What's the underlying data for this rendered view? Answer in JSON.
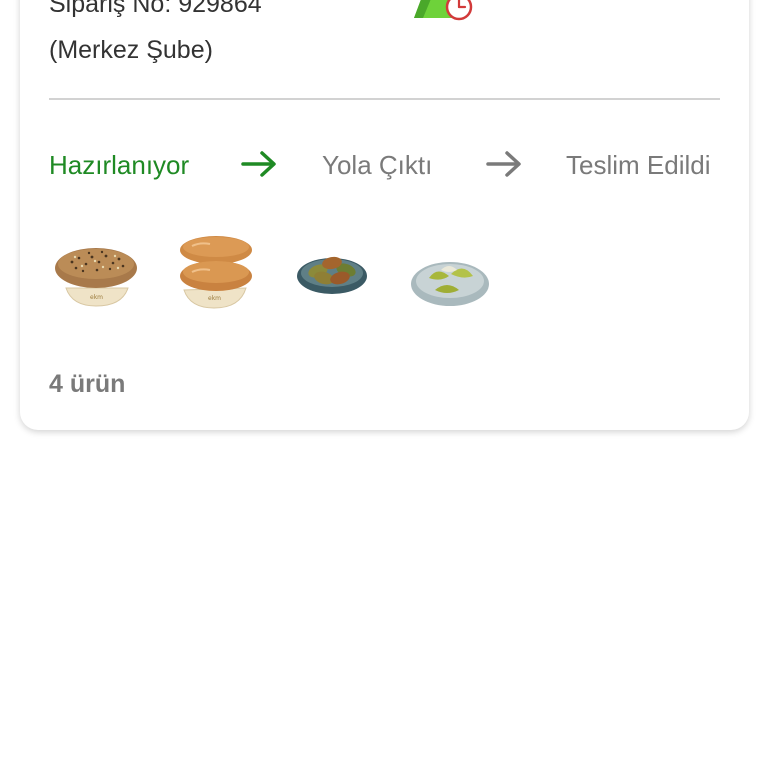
{
  "order": {
    "number_label": "Sipariş No: 929864",
    "branch": "(Merkez Şube)",
    "status_icon": "order-preparing-clock-icon"
  },
  "progress": {
    "steps": [
      {
        "label": "Hazırlanıyor",
        "active": true
      },
      {
        "label": "Yola Çıktı",
        "active": false
      },
      {
        "label": "Teslim Edildi",
        "active": false
      }
    ],
    "active_color": "#1f8a24",
    "inactive_color": "#7a7a7a"
  },
  "products": [
    {
      "icon": "seeded-bread-image"
    },
    {
      "icon": "double-bread-roll-image"
    },
    {
      "icon": "fried-pastry-plate-image"
    },
    {
      "icon": "dumpling-plate-image"
    }
  ],
  "summary": {
    "item_count": "4 ürün"
  }
}
